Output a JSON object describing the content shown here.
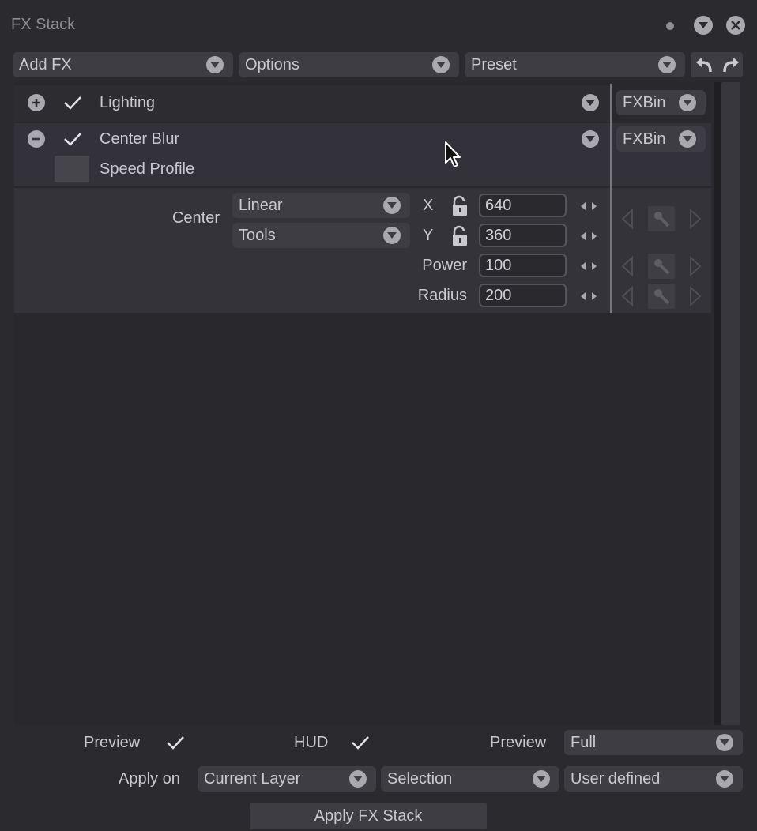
{
  "window": {
    "title": "FX Stack"
  },
  "toolbar": {
    "add_fx": "Add FX",
    "options": "Options",
    "preset": "Preset"
  },
  "effects": [
    {
      "name": "Lighting",
      "enabled": true,
      "bin": "FXBin",
      "expanded": false
    },
    {
      "name": "Center Blur",
      "enabled": true,
      "bin": "FXBin",
      "expanded": true
    }
  ],
  "speed_profile": {
    "label": "Speed Profile"
  },
  "params": {
    "center_label": "Center",
    "mode": "Linear",
    "tools": "Tools",
    "x_label": "X",
    "x_value": "640",
    "y_label": "Y",
    "y_value": "360",
    "power_label": "Power",
    "power_value": "100",
    "radius_label": "Radius",
    "radius_value": "200"
  },
  "footer": {
    "preview_label": "Preview",
    "preview_checked": true,
    "hud_label": "HUD",
    "hud_checked": true,
    "preview_quality_label": "Preview",
    "preview_quality": "Full",
    "apply_on_label": "Apply on",
    "apply_layer": "Current Layer",
    "apply_selection": "Selection",
    "apply_range": "User defined",
    "apply_button": "Apply FX Stack"
  },
  "colors": {
    "background": "#2b2a2f",
    "control": "#3e3d43",
    "text": "#c9c8ce",
    "icon": "#a9a8ae"
  }
}
